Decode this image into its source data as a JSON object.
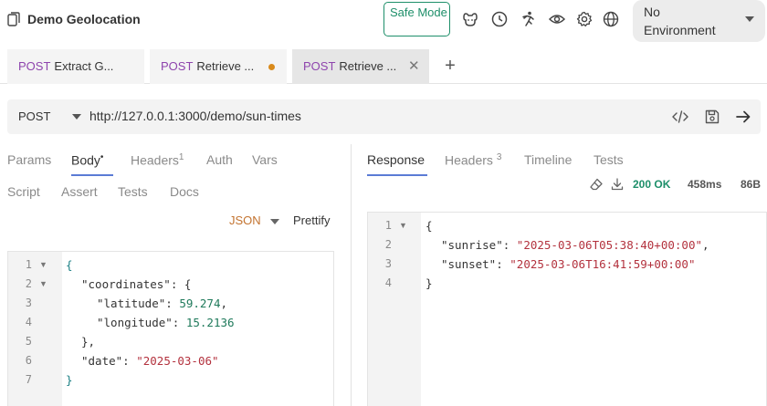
{
  "header": {
    "collection_title": "Demo Geolocation",
    "safe_mode_label": "Safe Mode",
    "environment": "No Environment",
    "icons": [
      "collection-icon",
      "dog-icon",
      "clock-icon",
      "runner-icon",
      "eye-icon",
      "gear-icon",
      "globe-icon"
    ]
  },
  "tabs": [
    {
      "method": "POST",
      "name": "Extract G...",
      "state": "normal"
    },
    {
      "method": "POST",
      "name": "Retrieve ...",
      "state": "unsaved"
    },
    {
      "method": "POST",
      "name": "Retrieve ...",
      "state": "active"
    }
  ],
  "request": {
    "method": "POST",
    "url": "http://127.0.0.1:3000/demo/sun-times"
  },
  "request_pane": {
    "tabs_row1": [
      {
        "label": "Params",
        "sup": ""
      },
      {
        "label": "Body",
        "sup": "•"
      },
      {
        "label": "Headers",
        "sup": "1"
      },
      {
        "label": "Auth",
        "sup": ""
      },
      {
        "label": "Vars",
        "sup": ""
      }
    ],
    "tabs_row2": [
      {
        "label": "Script"
      },
      {
        "label": "Assert"
      },
      {
        "label": "Tests"
      },
      {
        "label": "Docs"
      }
    ],
    "body_mode": "JSON",
    "prettify_label": "Prettify",
    "body_lines": [
      "1",
      "2",
      "3",
      "4",
      "5",
      "6",
      "7"
    ],
    "body_code": {
      "open_brace": "{",
      "coordinates_key": "\"coordinates\"",
      "lat_key": "\"latitude\"",
      "lat_val": "59.274",
      "lon_key": "\"longitude\"",
      "lon_val": "15.2136",
      "close_inner": "},",
      "date_key": "\"date\"",
      "date_val": "\"2025-03-06\"",
      "close_brace": "}"
    }
  },
  "response_pane": {
    "tabs": [
      {
        "label": "Response",
        "sup": ""
      },
      {
        "label": "Headers",
        "sup": "3"
      },
      {
        "label": "Timeline",
        "sup": ""
      },
      {
        "label": "Tests",
        "sup": ""
      }
    ],
    "status": "200 OK",
    "time": "458ms",
    "size": "86B",
    "lines": [
      "1",
      "2",
      "3",
      "4"
    ],
    "code": {
      "open_brace": "{",
      "sunrise_key": "\"sunrise\"",
      "sunrise_val": "\"2025-03-06T05:38:40+00:00\"",
      "sunset_key": "\"sunset\"",
      "sunset_val": "\"2025-03-06T16:41:59+00:00\"",
      "close_brace": "}"
    }
  },
  "colors": {
    "accent": "#5b7bd5",
    "method": "#8e44ad",
    "status_ok": "#1e8f6a",
    "json_mode": "#c3732f",
    "unsaved_dot": "#d98a1b"
  }
}
